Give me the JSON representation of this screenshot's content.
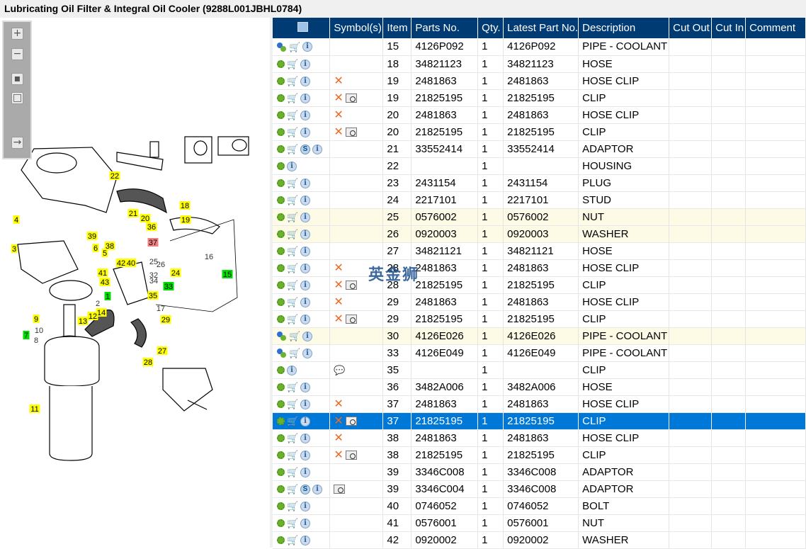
{
  "title": "Lubricating Oil Filter & Integral Oil Cooler (9288L001JBHL0784)",
  "watermark": "英金狮",
  "toolbar": [
    "zoom-in",
    "zoom-out",
    "fit-all",
    "fit-window",
    "toggle-panel"
  ],
  "callouts": [
    {
      "t": "22",
      "c": "yellow"
    },
    {
      "t": "21",
      "c": "yellow"
    },
    {
      "t": "20",
      "c": "yellow"
    },
    {
      "t": "18",
      "c": "yellow"
    },
    {
      "t": "19",
      "c": "yellow"
    },
    {
      "t": "36",
      "c": "yellow"
    },
    {
      "t": "4",
      "c": "yellow"
    },
    {
      "t": "39",
      "c": "yellow"
    },
    {
      "t": "38",
      "c": "yellow"
    },
    {
      "t": "37",
      "c": "red"
    },
    {
      "t": "3",
      "c": "yellow"
    },
    {
      "t": "6",
      "c": "yellow"
    },
    {
      "t": "5",
      "c": "yellow"
    },
    {
      "t": "16",
      "c": "none"
    },
    {
      "t": "25",
      "c": "none"
    },
    {
      "t": "26",
      "c": "none"
    },
    {
      "t": "24",
      "c": "yellow"
    },
    {
      "t": "15",
      "c": "green"
    },
    {
      "t": "41",
      "c": "yellow"
    },
    {
      "t": "42",
      "c": "yellow"
    },
    {
      "t": "40",
      "c": "yellow"
    },
    {
      "t": "43",
      "c": "yellow"
    },
    {
      "t": "32",
      "c": "none"
    },
    {
      "t": "34",
      "c": "none"
    },
    {
      "t": "33",
      "c": "green"
    },
    {
      "t": "1",
      "c": "green"
    },
    {
      "t": "35",
      "c": "yellow"
    },
    {
      "t": "2",
      "c": "none"
    },
    {
      "t": "17",
      "c": "none"
    },
    {
      "t": "14",
      "c": "yellow"
    },
    {
      "t": "12",
      "c": "yellow"
    },
    {
      "t": "13",
      "c": "yellow"
    },
    {
      "t": "29",
      "c": "yellow"
    },
    {
      "t": "9",
      "c": "yellow"
    },
    {
      "t": "10",
      "c": "none"
    },
    {
      "t": "7",
      "c": "green"
    },
    {
      "t": "8",
      "c": "none"
    },
    {
      "t": "27",
      "c": "yellow"
    },
    {
      "t": "28",
      "c": "yellow"
    },
    {
      "t": "11",
      "c": "yellow"
    }
  ],
  "colors": {
    "yellow": "#ffff00",
    "green": "#00e000",
    "red": "#f08080",
    "header": "#003b73",
    "selected": "#0078d7",
    "highlight": "#fdfbe6"
  },
  "columns": [
    "",
    "Symbol(s)",
    "Item",
    "Parts No.",
    "Qty.",
    "Latest Part No.",
    "Description",
    "Cut Out",
    "Cut In",
    "Comment"
  ],
  "rows": [
    {
      "gear": "multi",
      "cart": true,
      "s": false,
      "sym": [],
      "item": "15",
      "part": "4126P092",
      "qty": "1",
      "latest": "4126P092",
      "desc": "PIPE - COOLANT"
    },
    {
      "gear": "single",
      "cart": true,
      "s": false,
      "sym": [],
      "item": "18",
      "part": "34821123",
      "qty": "1",
      "latest": "34821123",
      "desc": "HOSE"
    },
    {
      "gear": "single",
      "cart": true,
      "s": false,
      "sym": [
        "x"
      ],
      "item": "19",
      "part": "2481863",
      "qty": "1",
      "latest": "2481863",
      "desc": "HOSE CLIP"
    },
    {
      "gear": "single",
      "cart": true,
      "s": false,
      "sym": [
        "x",
        "book"
      ],
      "item": "19",
      "part": "21825195",
      "qty": "1",
      "latest": "21825195",
      "desc": "CLIP"
    },
    {
      "gear": "single",
      "cart": true,
      "s": false,
      "sym": [
        "x"
      ],
      "item": "20",
      "part": "2481863",
      "qty": "1",
      "latest": "2481863",
      "desc": "HOSE CLIP"
    },
    {
      "gear": "single",
      "cart": true,
      "s": false,
      "sym": [
        "x",
        "book"
      ],
      "item": "20",
      "part": "21825195",
      "qty": "1",
      "latest": "21825195",
      "desc": "CLIP"
    },
    {
      "gear": "single",
      "cart": true,
      "s": true,
      "sym": [],
      "item": "21",
      "part": "33552414",
      "qty": "1",
      "latest": "33552414",
      "desc": "ADAPTOR"
    },
    {
      "gear": "single",
      "cart": false,
      "s": false,
      "sym": [],
      "item": "22",
      "part": "",
      "qty": "1",
      "latest": "",
      "desc": "HOUSING"
    },
    {
      "gear": "single",
      "cart": true,
      "s": false,
      "sym": [],
      "item": "23",
      "part": "2431154",
      "qty": "1",
      "latest": "2431154",
      "desc": "PLUG"
    },
    {
      "gear": "single",
      "cart": true,
      "s": false,
      "sym": [],
      "item": "24",
      "part": "2217101",
      "qty": "1",
      "latest": "2217101",
      "desc": "STUD"
    },
    {
      "gear": "single",
      "cart": true,
      "s": false,
      "sym": [],
      "item": "25",
      "part": "0576002",
      "qty": "1",
      "latest": "0576002",
      "desc": "NUT",
      "hl": true
    },
    {
      "gear": "single",
      "cart": true,
      "s": false,
      "sym": [],
      "item": "26",
      "part": "0920003",
      "qty": "1",
      "latest": "0920003",
      "desc": "WASHER",
      "hl": true
    },
    {
      "gear": "single",
      "cart": true,
      "s": false,
      "sym": [],
      "item": "27",
      "part": "34821121",
      "qty": "1",
      "latest": "34821121",
      "desc": "HOSE"
    },
    {
      "gear": "single",
      "cart": true,
      "s": false,
      "sym": [
        "x"
      ],
      "item": "28",
      "part": "2481863",
      "qty": "1",
      "latest": "2481863",
      "desc": "HOSE CLIP"
    },
    {
      "gear": "single",
      "cart": true,
      "s": false,
      "sym": [
        "x",
        "book"
      ],
      "item": "28",
      "part": "21825195",
      "qty": "1",
      "latest": "21825195",
      "desc": "CLIP"
    },
    {
      "gear": "single",
      "cart": true,
      "s": false,
      "sym": [
        "x"
      ],
      "item": "29",
      "part": "2481863",
      "qty": "1",
      "latest": "2481863",
      "desc": "HOSE CLIP"
    },
    {
      "gear": "single",
      "cart": true,
      "s": false,
      "sym": [
        "x",
        "book"
      ],
      "item": "29",
      "part": "21825195",
      "qty": "1",
      "latest": "21825195",
      "desc": "CLIP"
    },
    {
      "gear": "multi",
      "cart": true,
      "s": false,
      "sym": [],
      "item": "30",
      "part": "4126E026",
      "qty": "1",
      "latest": "4126E026",
      "desc": "PIPE - COOLANT",
      "hl": true
    },
    {
      "gear": "multi",
      "cart": true,
      "s": false,
      "sym": [],
      "item": "33",
      "part": "4126E049",
      "qty": "1",
      "latest": "4126E049",
      "desc": "PIPE - COOLANT"
    },
    {
      "gear": "single",
      "cart": false,
      "s": false,
      "sym": [
        "balloon"
      ],
      "item": "35",
      "part": "",
      "qty": "1",
      "latest": "",
      "desc": "CLIP"
    },
    {
      "gear": "single",
      "cart": true,
      "s": false,
      "sym": [],
      "item": "36",
      "part": "3482A006",
      "qty": "1",
      "latest": "3482A006",
      "desc": "HOSE"
    },
    {
      "gear": "single",
      "cart": true,
      "s": false,
      "sym": [
        "x"
      ],
      "item": "37",
      "part": "2481863",
      "qty": "1",
      "latest": "2481863",
      "desc": "HOSE CLIP"
    },
    {
      "gear": "single",
      "cart": true,
      "s": false,
      "sym": [
        "x",
        "book"
      ],
      "item": "37",
      "part": "21825195",
      "qty": "1",
      "latest": "21825195",
      "desc": "CLIP",
      "sel": true
    },
    {
      "gear": "single",
      "cart": true,
      "s": false,
      "sym": [
        "x"
      ],
      "item": "38",
      "part": "2481863",
      "qty": "1",
      "latest": "2481863",
      "desc": "HOSE CLIP"
    },
    {
      "gear": "single",
      "cart": true,
      "s": false,
      "sym": [
        "x",
        "book"
      ],
      "item": "38",
      "part": "21825195",
      "qty": "1",
      "latest": "21825195",
      "desc": "CLIP"
    },
    {
      "gear": "single",
      "cart": true,
      "s": false,
      "sym": [],
      "item": "39",
      "part": "3346C008",
      "qty": "1",
      "latest": "3346C008",
      "desc": "ADAPTOR"
    },
    {
      "gear": "single",
      "cart": true,
      "s": true,
      "sym": [
        "book"
      ],
      "item": "39",
      "part": "3346C004",
      "qty": "1",
      "latest": "3346C008",
      "desc": "ADAPTOR"
    },
    {
      "gear": "single",
      "cart": true,
      "s": false,
      "sym": [],
      "item": "40",
      "part": "0746052",
      "qty": "1",
      "latest": "0746052",
      "desc": "BOLT"
    },
    {
      "gear": "single",
      "cart": true,
      "s": false,
      "sym": [],
      "item": "41",
      "part": "0576001",
      "qty": "1",
      "latest": "0576001",
      "desc": "NUT"
    },
    {
      "gear": "single",
      "cart": true,
      "s": false,
      "sym": [],
      "item": "42",
      "part": "0920002",
      "qty": "1",
      "latest": "0920002",
      "desc": "WASHER"
    }
  ],
  "icons": {
    "s_badge": "S",
    "info": "i",
    "x": "✕",
    "cart": "🛒",
    "balloon": "💬"
  }
}
